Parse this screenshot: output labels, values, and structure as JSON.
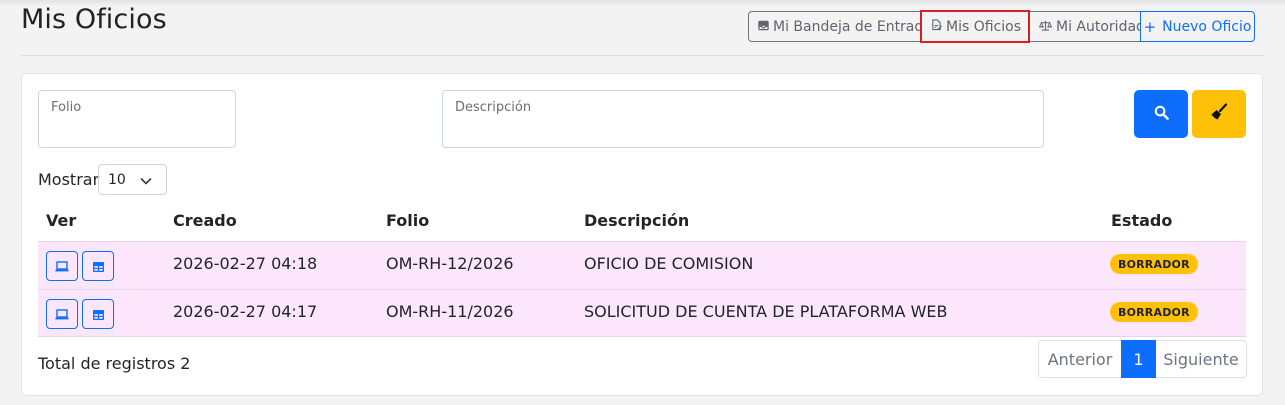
{
  "page": {
    "title": "Mis Oficios"
  },
  "nav": {
    "inbox_label": "Mi Bandeja de Entrada",
    "my_offices_label": "Mis Oficios",
    "authority_label": "Mi Autoridad",
    "new_office_label": "Nuevo Oficio"
  },
  "filters": {
    "folio_label": "Folio",
    "folio_value": "",
    "description_label": "Descripción",
    "description_value": "",
    "search_icon": "search-icon",
    "clear_icon": "broom-icon"
  },
  "pagesize": {
    "label": "Mostrar",
    "value": "10"
  },
  "table": {
    "headers": [
      "Ver",
      "Creado",
      "Folio",
      "Descripción",
      "Estado"
    ],
    "rows": [
      {
        "created": "2026-02-27 04:18",
        "folio": "OM-RH-12/2026",
        "description": "OFICIO DE COMISION",
        "status": "BORRADOR"
      },
      {
        "created": "2026-02-27 04:17",
        "folio": "OM-RH-11/2026",
        "description": "SOLICITUD DE CUENTA DE PLATAFORMA WEB",
        "status": "BORRADOR"
      }
    ]
  },
  "footer": {
    "total_text": "Total de registros 2",
    "prev_label": "Anterior",
    "current_page": "1",
    "next_label": "Siguiente"
  },
  "colors": {
    "primary": "#0d6efd",
    "warning": "#ffc107",
    "row_highlight": "#fbe6fb",
    "active_outline": "#d32027"
  }
}
